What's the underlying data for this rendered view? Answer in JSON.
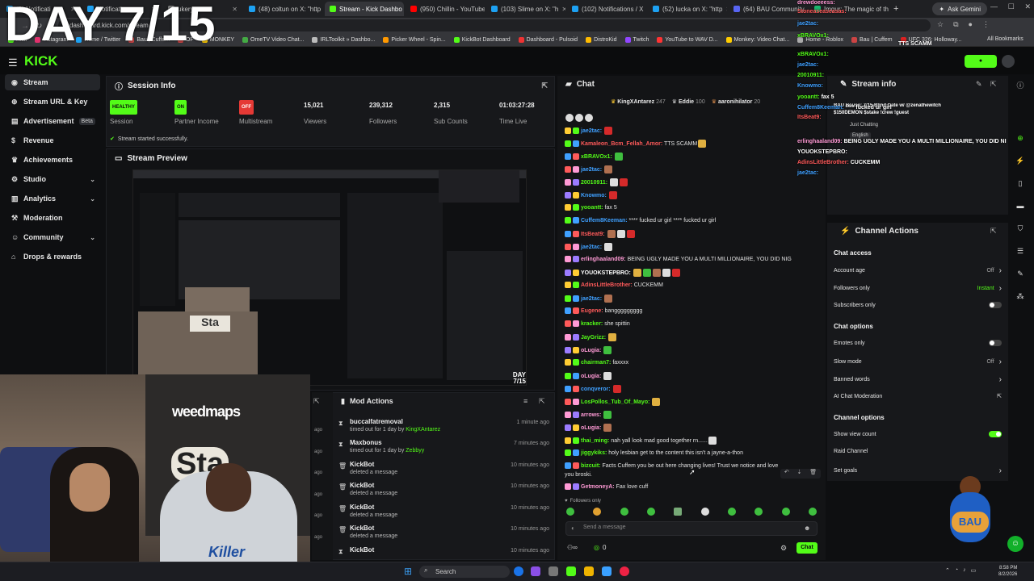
{
  "browser": {
    "tabs": [
      {
        "label": "(8) Notificati"
      },
      {
        "label": "Notificati"
      },
      {
        "label": "ukery on"
      },
      {
        "label": "(48) coltun on X: \"http"
      },
      {
        "label": "Stream - Kick Dashbo"
      },
      {
        "label": "(950) Chillin - YouTube"
      },
      {
        "label": "(103) Slime on X: \"h"
      },
      {
        "label": "(102) Notifications / X"
      },
      {
        "label": "(52) lucka on X: \"http"
      },
      {
        "label": "(64) BAU Community"
      },
      {
        "label": "Imgur: The magic of th"
      }
    ],
    "gemini_label": "Ask Gemini",
    "url": "dashboard.kick.com/stream",
    "bookmarks": [
      "Kick",
      "Instagram",
      "Home / Twitter",
      "Bau | Cuffem",
      "OF",
      "MONKEY",
      "OmeTV Video Chat...",
      "IRLToolkit » Dashbo...",
      "Picker Wheel - Spin...",
      "KickBot Dashboard",
      "Dashboard - Pulsoid",
      "DistroKid",
      "Twitch",
      "YouTube to WAV D...",
      "Monkey: Video Chat...",
      "Home - Roblox",
      "Bau | Cuffem",
      "UFC 326: Holloway..."
    ],
    "all_bookmarks": "All Bookmarks"
  },
  "overlay": {
    "day": "DAY 7/15"
  },
  "kick": {
    "logo": "KICK"
  },
  "sidebar": {
    "items": [
      {
        "label": "Stream"
      },
      {
        "label": "Stream URL & Key"
      },
      {
        "label": "Advertisement",
        "badge": "Beta"
      },
      {
        "label": "Revenue"
      },
      {
        "label": "Achievements"
      },
      {
        "label": "Studio"
      },
      {
        "label": "Analytics"
      },
      {
        "label": "Moderation"
      },
      {
        "label": "Community"
      },
      {
        "label": "Drops & rewards"
      }
    ]
  },
  "session": {
    "title": "Session Info",
    "stats": [
      {
        "value": "HEALTHY",
        "label": "Session"
      },
      {
        "value": "ON",
        "label": "Partner Income"
      },
      {
        "value": "OFF",
        "label": "Multistream"
      },
      {
        "value": "15,021",
        "label": "Viewers"
      },
      {
        "value": "239,312",
        "label": "Followers"
      },
      {
        "value": "2,315",
        "label": "Sub Counts"
      },
      {
        "value": "01:03:27:28",
        "label": "Time Live"
      }
    ],
    "status": "Stream started successfully."
  },
  "preview": {
    "title": "Stream Preview",
    "overlay": "DAY 7/15"
  },
  "webcam": {
    "shirt_text": "weedmaps",
    "banner": "Sta",
    "hoodie": "Killer"
  },
  "mod": {
    "title": "Mod Actions",
    "rows": [
      {
        "name": "buccalfatremoval",
        "action": "timed out for 1 day by",
        "by": "KingXAntarez",
        "time": "1 minute ago"
      },
      {
        "name": "Maxbonus",
        "action": "timed out for 1 day by",
        "by": "Zebbyy",
        "time": "7 minutes ago"
      },
      {
        "name": "KickBot",
        "action": "deleted a message",
        "by": "",
        "time": "10 minutes ago"
      },
      {
        "name": "KickBot",
        "action": "deleted a message",
        "by": "",
        "time": "10 minutes ago"
      },
      {
        "name": "KickBot",
        "action": "deleted a message",
        "by": "",
        "time": "10 minutes ago"
      },
      {
        "name": "KickBot",
        "action": "deleted a message",
        "by": "",
        "time": "10 minutes ago"
      },
      {
        "name": "KickBot",
        "action": "",
        "by": "",
        "time": "10 minutes ago"
      }
    ],
    "side_times": [
      "ago",
      "ago",
      "ago",
      "ago",
      "ago",
      "ago",
      "ago"
    ]
  },
  "chat": {
    "title": "Chat",
    "top_gifters": [
      {
        "name": "KingXAntarez",
        "count": "247"
      },
      {
        "name": "Eddie",
        "count": "100"
      },
      {
        "name": "aaronihilator",
        "count": "20"
      }
    ],
    "messages": [
      {
        "user": "jae2tac:",
        "color": "#3fa0ff",
        "text": ""
      },
      {
        "user": "Kamaleon_Bcm_Fellah_Amor:",
        "color": "#ff5a5a",
        "text": "TTS SCAMM"
      },
      {
        "user": "xBRAVOx1:",
        "color": "#53fc18",
        "text": ""
      },
      {
        "user": "jae2tac:",
        "color": "#3fa0ff",
        "text": ""
      },
      {
        "user": "20010911:",
        "color": "#53fc18",
        "text": ""
      },
      {
        "user": "Knowmo:",
        "color": "#3fa0ff",
        "text": ""
      },
      {
        "user": "yooantt:",
        "color": "#53fc18",
        "text": "fax 5"
      },
      {
        "user": "Cuffem8Keeman:",
        "color": "#3fa0ff",
        "text": "**** fucked ur girl    **** fucked ur girl"
      },
      {
        "user": "ItsBeat9:",
        "color": "#ff5a5a",
        "text": ""
      },
      {
        "user": "jae2tac:",
        "color": "#3fa0ff",
        "text": ""
      },
      {
        "user": "erlinghaaland09:",
        "color": "#ff9ad5",
        "text": "BEING UGLY MADE YOU A MULTI MILLIONAIRE, YOU DID NIG"
      },
      {
        "user": "YOUOKSTEPBRO:",
        "color": "#ffffff",
        "text": ""
      },
      {
        "user": "AdinsLittleBrother:",
        "color": "#ff5a5a",
        "text": "CUCKEMM"
      },
      {
        "user": "jae2tac:",
        "color": "#3fa0ff",
        "text": ""
      },
      {
        "user": "Eugene:",
        "color": "#ff5a5a",
        "text": "banggggggggg"
      },
      {
        "user": "kracker:",
        "color": "#53fc18",
        "text": "she spittin"
      },
      {
        "user": "JayGrizz:",
        "color": "#53fc18",
        "text": ""
      },
      {
        "user": "oLugia:",
        "color": "#ff9ad5",
        "text": ""
      },
      {
        "user": "chairman7:",
        "color": "#53fc18",
        "text": "faxxxx"
      },
      {
        "user": "oLugia:",
        "color": "#ff9ad5",
        "text": ""
      },
      {
        "user": "conqveror:",
        "color": "#3fa0ff",
        "text": ""
      },
      {
        "user": "LosPollos_Tub_Of_Mayo:",
        "color": "#53fc18",
        "text": ""
      },
      {
        "user": "arrows:",
        "color": "#ff9ad5",
        "text": ""
      },
      {
        "user": "oLugia:",
        "color": "#ff9ad5",
        "text": ""
      },
      {
        "user": "thai_ming:",
        "color": "#53fc18",
        "text": "nah yall look mad good together rn......"
      },
      {
        "user": "jiggykiks:",
        "color": "#53fc18",
        "text": "holy lesbian get to the content this isn't a jayne-a-thon"
      },
      {
        "user": "bizcuit:",
        "color": "#53fc18",
        "text": "Facts Cuffem you be out here changing lives! Trust we notice and love"
      },
      {
        "user": "",
        "color": "#ffffff",
        "text": "you broski."
      },
      {
        "user": "GetmoneyA:",
        "color": "#ff9ad5",
        "text": "Fax love cuff"
      }
    ],
    "followers_only": "Followers only",
    "send_placeholder": "Send a message",
    "points": "0",
    "chat_button": "Chat"
  },
  "overlay_chat": [
    {
      "user": "drewdoeeess:",
      "text": ""
    },
    {
      "user": "Stoneaseaseasas:",
      "text": ""
    },
    {
      "user": "jae2tac:",
      "text": ""
    },
    {
      "user": "Kamaleon_Bcm:",
      "text": "TTS SCAMM"
    },
    {
      "user": "xBRAVOx1:",
      "text": ""
    },
    {
      "user": "jae2tac:",
      "text": ""
    },
    {
      "user": "20010911:",
      "text": ""
    },
    {
      "user": "Knowmo:",
      "text": ""
    },
    {
      "user": "yooantt:",
      "text": "fax 5"
    },
    {
      "user": "Cuffem8Keeman:",
      "text": "**** fucked ur girl"
    },
    {
      "user": "ItsBeat9:",
      "text": ""
    },
    {
      "user": "jae2tac:",
      "text": ""
    },
    {
      "user": "erlinghaaland09:",
      "text": "BEING UGLY MADE YOU A MULTI MILLIONAIRE, YOU DID NI"
    },
    {
      "user": "YOUOKSTEPBRO:",
      "text": ""
    },
    {
      "user": "AdinsLittleBrother:",
      "text": "CUCKEMM"
    },
    {
      "user": "jae2tac:",
      "text": ""
    }
  ],
  "stream_info": {
    "title": "Stream info",
    "stream_title": "BAU House: 7/15 Blind Date w/ @zenathewitch",
    "stream_sub": "$150DEMON $stake !crew !guest",
    "category": "Just Chatting",
    "language": "English"
  },
  "channel_actions": {
    "title": "Channel Actions",
    "sections": [
      {
        "heading": "Chat access",
        "rows": [
          {
            "label": "Account age",
            "value": "Off",
            "control": "chevron"
          },
          {
            "label": "Followers only",
            "value": "Instant",
            "control": "chevron"
          },
          {
            "label": "Subscribers only",
            "value": "",
            "control": "toggle-off"
          }
        ]
      },
      {
        "heading": "Chat options",
        "rows": [
          {
            "label": "Emotes only",
            "value": "",
            "control": "toggle-off"
          },
          {
            "label": "Slow mode",
            "value": "Off",
            "control": "chevron"
          },
          {
            "label": "Banned words",
            "value": "",
            "control": "chevron"
          },
          {
            "label": "AI Chat Moderation",
            "value": "",
            "control": "external"
          }
        ]
      },
      {
        "heading": "Channel options",
        "rows": [
          {
            "label": "Show view count",
            "value": "",
            "control": "toggle-on"
          },
          {
            "label": "Raid Channel",
            "value": "",
            "control": "none"
          },
          {
            "label": "Set goals",
            "value": "",
            "control": "chevron"
          }
        ]
      }
    ]
  },
  "taskbar": {
    "search": "Search",
    "time": "8:58 PM",
    "date": "8/2/2026"
  },
  "colors": {
    "kick_green": "#53fc18",
    "bg": "#0e0f11",
    "panel": "#17181b",
    "off_red": "#e53935"
  }
}
